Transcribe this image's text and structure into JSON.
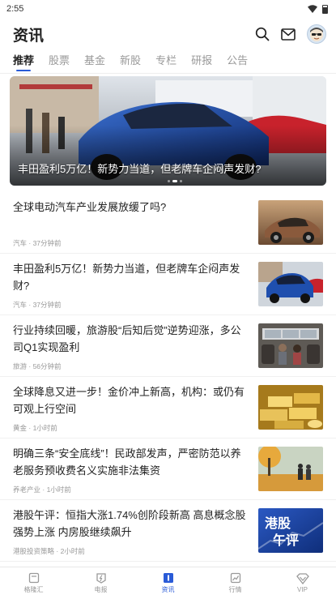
{
  "status_bar": {
    "time": "2:55"
  },
  "header": {
    "title": "资讯",
    "search_icon": "search-icon",
    "mail_icon": "mail-icon",
    "avatar_icon": "avatar"
  },
  "tabs": [
    {
      "label": "推荐",
      "active": true
    },
    {
      "label": "股票",
      "active": false
    },
    {
      "label": "基金",
      "active": false
    },
    {
      "label": "新股",
      "active": false
    },
    {
      "label": "专栏",
      "active": false
    },
    {
      "label": "研报",
      "active": false
    },
    {
      "label": "公告",
      "active": false
    }
  ],
  "banner": {
    "title": "丰田盈利5万亿！新势力当道，但老牌车企闷声发财?"
  },
  "news": [
    {
      "title": "全球电动汽车产业发展放缓了吗?",
      "source": "汽车",
      "time": "37分钟前",
      "thumb": "car-sunset"
    },
    {
      "title": "丰田盈利5万亿！新势力当道，但老牌车企闷声发财?",
      "source": "汽车",
      "time": "37分钟前",
      "thumb": "car-showroom"
    },
    {
      "title": "行业持续回暖，旅游股“后知后觉”逆势迎涨，多公司Q1实现盈利",
      "source": "旅游",
      "time": "56分钟前",
      "thumb": "bus-interior"
    },
    {
      "title": "全球降息又进一步！金价冲上新高，机构：或仍有可观上行空间",
      "source": "黄金",
      "time": "1小时前",
      "thumb": "gold-bars"
    },
    {
      "title": "明确三条“安全底线”！民政部发声，严密防范以养老服务预收费名义实施非法集资",
      "source": "养老产业",
      "time": "1小时前",
      "thumb": "elderly-walk"
    },
    {
      "title": "港股午评：恒指大涨1.74%创阶段新高 高息概念股强势上涨 内房股继续飙升",
      "source": "港股投资策略",
      "time": "2小时前",
      "thumb": "hk-noon",
      "thumb_text_1": "港股",
      "thumb_text_2": "午评"
    }
  ],
  "bottom_nav": [
    {
      "label": "格隆汇",
      "icon": "home-icon",
      "active": false
    },
    {
      "label": "电报",
      "icon": "flash-icon",
      "active": false
    },
    {
      "label": "资讯",
      "icon": "news-icon",
      "active": true
    },
    {
      "label": "行情",
      "icon": "chart-icon",
      "active": false
    },
    {
      "label": "VIP",
      "icon": "vip-icon",
      "active": false
    }
  ],
  "colors": {
    "accent": "#2a5bd7",
    "text": "#222222",
    "muted": "#999999"
  }
}
